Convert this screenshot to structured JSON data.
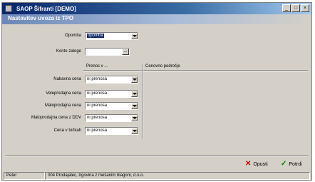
{
  "window": {
    "title": "SAOP Šifranti [DEMO]",
    "buttons": [
      "_",
      "□",
      "×"
    ]
  },
  "header": {
    "title": "Nastavitev uvoza iz TPO"
  },
  "form": {
    "opomba": {
      "label": "Opomba",
      "value": "opomba"
    },
    "konto": {
      "label": "Konto zaloge",
      "value": "",
      "button": "..."
    }
  },
  "table": {
    "col_prenos": "Prenos v ...",
    "col_cenovno": "Cenovno področje",
    "rows": [
      {
        "label": "Nabavna cena",
        "value": "ni prenosa"
      },
      {
        "label": "Veleprodajna cena",
        "value": "ni prenosa"
      },
      {
        "label": "Maloprodajna cena",
        "value": "ni prenosa"
      },
      {
        "label": "Maloprodajna cena z DDV",
        "value": "ni prenosa"
      },
      {
        "label": "Cena v točkah",
        "value": "ni prenosa"
      }
    ]
  },
  "actions": {
    "cancel": {
      "label": "Opusti",
      "icon": "✕",
      "color": "#cc0000"
    },
    "confirm": {
      "label": "Potrdi",
      "icon": "✓",
      "color": "#008000"
    }
  },
  "status": {
    "user": "Peter",
    "company": "004  Prodajalec, trgovina z mešanim blagom, d.o.o."
  }
}
